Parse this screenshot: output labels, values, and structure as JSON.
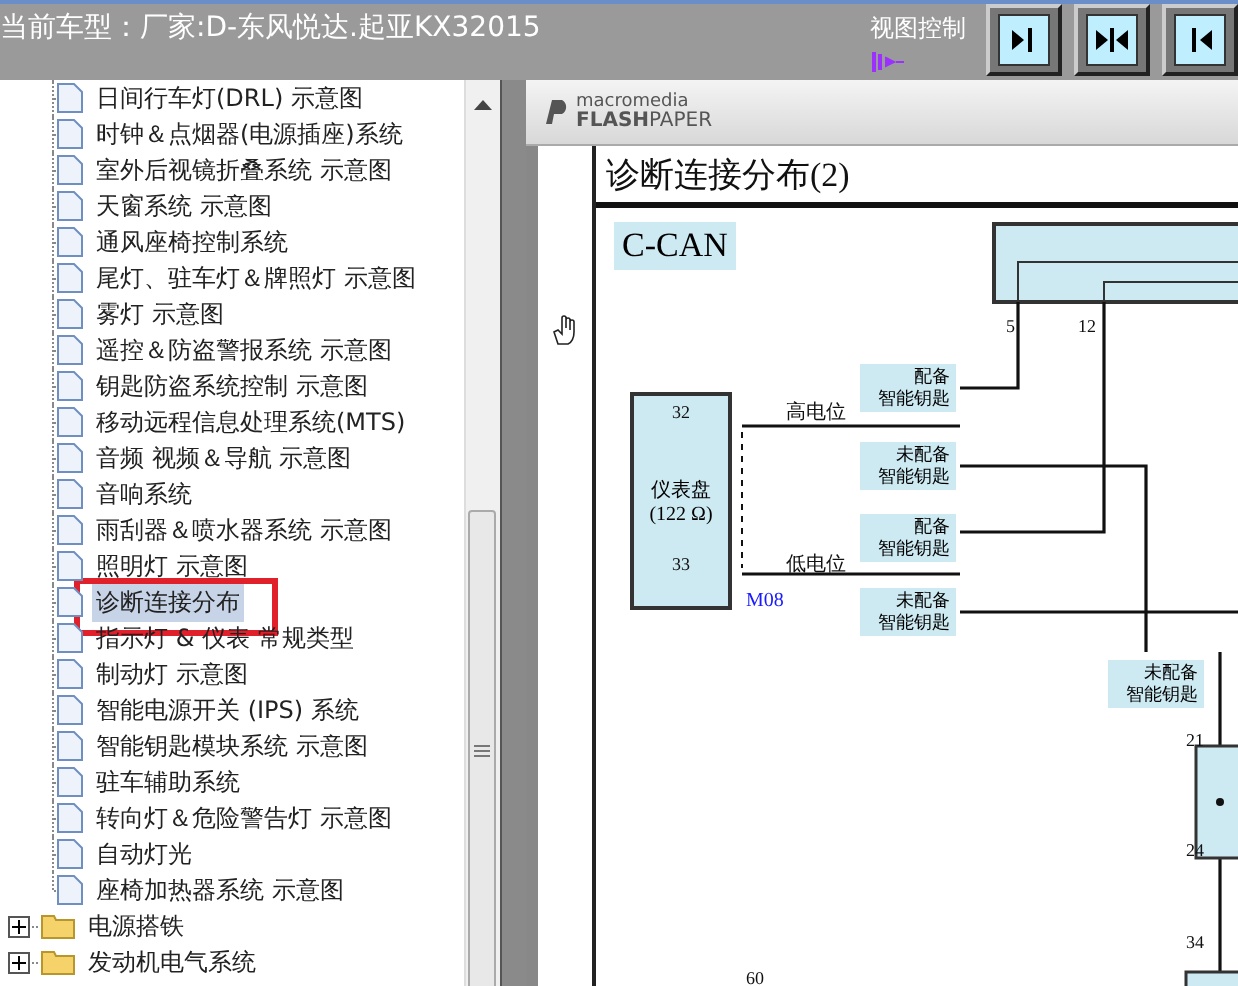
{
  "top_bar": {
    "title": "当前车型：厂家:D-东风悦达.起亚KX32015",
    "view_control": "视图控制",
    "view_buttons": [
      {
        "kind": "expand-right"
      },
      {
        "kind": "collapse"
      },
      {
        "kind": "expand-left"
      }
    ]
  },
  "tree": [
    {
      "kind": "doc",
      "label": "日间行车灯(DRL) 示意图",
      "selected": false,
      "marked": false
    },
    {
      "kind": "doc",
      "label": "时钟＆点烟器(电源插座)系统",
      "selected": false,
      "marked": false
    },
    {
      "kind": "doc",
      "label": "室外后视镜折叠系统 示意图",
      "selected": false,
      "marked": false
    },
    {
      "kind": "doc",
      "label": "天窗系统 示意图",
      "selected": false,
      "marked": false
    },
    {
      "kind": "doc",
      "label": "通风座椅控制系统",
      "selected": false,
      "marked": false
    },
    {
      "kind": "doc",
      "label": "尾灯、驻车灯＆牌照灯 示意图",
      "selected": false,
      "marked": false
    },
    {
      "kind": "doc",
      "label": "雾灯 示意图",
      "selected": false,
      "marked": false
    },
    {
      "kind": "doc",
      "label": "遥控＆防盗警报系统 示意图",
      "selected": false,
      "marked": false
    },
    {
      "kind": "doc",
      "label": "钥匙防盗系统控制 示意图",
      "selected": false,
      "marked": false
    },
    {
      "kind": "doc",
      "label": "移动远程信息处理系统(MTS)",
      "selected": false,
      "marked": false
    },
    {
      "kind": "doc",
      "label": "音频 视频＆导航 示意图",
      "selected": false,
      "marked": false
    },
    {
      "kind": "doc",
      "label": "音响系统",
      "selected": false,
      "marked": false
    },
    {
      "kind": "doc",
      "label": "雨刮器＆喷水器系统 示意图",
      "selected": false,
      "marked": false
    },
    {
      "kind": "doc",
      "label": "照明灯 示意图",
      "selected": false,
      "marked": false
    },
    {
      "kind": "doc",
      "label": "诊断连接分布",
      "selected": true,
      "marked": true
    },
    {
      "kind": "doc",
      "label": "指示灯 & 仪表 常规类型",
      "selected": false,
      "marked": false
    },
    {
      "kind": "doc",
      "label": "制动灯 示意图",
      "selected": false,
      "marked": false
    },
    {
      "kind": "doc",
      "label": "智能电源开关 (IPS) 系统",
      "selected": false,
      "marked": false
    },
    {
      "kind": "doc",
      "label": "智能钥匙模块系统 示意图",
      "selected": false,
      "marked": false
    },
    {
      "kind": "doc",
      "label": "驻车辅助系统",
      "selected": false,
      "marked": false
    },
    {
      "kind": "doc",
      "label": "转向灯＆危险警告灯 示意图",
      "selected": false,
      "marked": false
    },
    {
      "kind": "doc",
      "label": "自动灯光",
      "selected": false,
      "marked": false
    },
    {
      "kind": "doc",
      "label": "座椅加热器系统 示意图",
      "selected": false,
      "marked": false
    },
    {
      "kind": "folder",
      "label": "电源搭铁",
      "expanded": false
    },
    {
      "kind": "folder",
      "label": "发动机电气系统",
      "expanded": false
    }
  ],
  "viewer": {
    "brand_top": "macromedia",
    "brand_bold": "FLASH",
    "brand_light": "PAPER"
  },
  "document": {
    "title": "诊断连接分布(2)",
    "bus_label": "C-CAN",
    "module_name": "仪表盘",
    "module_resistance": "(122 Ω)",
    "connector": "M08",
    "pins": [
      "5",
      "12",
      "32",
      "33",
      "21",
      "24",
      "34",
      "60"
    ],
    "signals": [
      "高电位",
      "低电位"
    ],
    "options": [
      {
        "line1": "配备",
        "line2": "智能钥匙"
      },
      {
        "line1": "未配备",
        "line2": "智能钥匙"
      },
      {
        "line1": "配备",
        "line2": "智能钥匙"
      },
      {
        "line1": "未配备",
        "line2": "智能钥匙"
      },
      {
        "line1": "未配备",
        "line2": "智能钥匙"
      }
    ]
  }
}
